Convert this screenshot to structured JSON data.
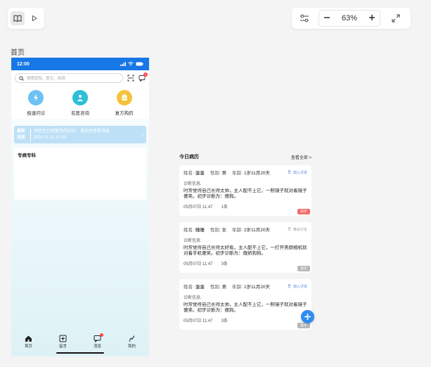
{
  "toolbar": {
    "left": {
      "book_icon": "book-open-icon",
      "play_icon": "play-icon"
    },
    "right": {
      "settings_icon": "sliders-icon",
      "zoom_out_icon": "minus-icon",
      "zoom_value": "63%",
      "zoom_in_icon": "plus-icon",
      "fullscreen_icon": "expand-icon"
    }
  },
  "page_label": "首页",
  "phone": {
    "status_bar": {
      "time": "12:00",
      "bg_color": "#1677e5"
    },
    "search": {
      "placeholder": "搜索医院、医生、疾病"
    },
    "message_badge": "2",
    "quick_actions": [
      {
        "label": "极速问诊",
        "icon": "lightning-icon",
        "color": "#6cc2f3"
      },
      {
        "label": "名医咨询",
        "icon": "doctor-icon",
        "color": "#2bbfd8"
      },
      {
        "label": "复方购药",
        "icon": "medicine-icon",
        "color": "#f5c23a"
      }
    ],
    "notice": {
      "tag": "最新消息",
      "text": "肖医生已回复你的问诊，请及时查看消息",
      "date": "2024.11.01 10:30"
    },
    "specialty_title": "专病专科",
    "tabbar": [
      {
        "label": "首页",
        "icon": "home-icon"
      },
      {
        "label": "留言",
        "icon": "compose-icon"
      },
      {
        "label": "消息",
        "icon": "message-icon"
      },
      {
        "label": "我的",
        "icon": "user-icon"
      }
    ]
  },
  "records": {
    "title": "今日病历",
    "view_all": "查看全部 >",
    "name_label": "姓名:",
    "gender_label": "性别:",
    "age_label": "年龄:",
    "diag_label": "诊断信息:",
    "items": [
      {
        "name": "蛋蛋",
        "gender": "男",
        "age": "1岁11月20天",
        "action": "加入讨论",
        "desc": "时常觉得自己长得太帅，主人配不上它，一照镜子就对着镜子傻笑。初步诊断为：傻狗。",
        "time": "05月07日 11:47",
        "count": "1条",
        "tag": "新步",
        "tag_color": "#f26d6d"
      },
      {
        "name": "睡睡",
        "gender": "女",
        "age": "2岁11月20天",
        "action": "移出讨论",
        "desc": "时常觉得自己长得太好看，主人配不上它，一打开美颜相机就对着手机傻笑。初步诊断为：傲娇狗狗。",
        "time": "05月07日 11:47",
        "count": "3条",
        "tag": "复步",
        "tag_color": "#b8b8b8"
      },
      {
        "name": "蛋蛋",
        "gender": "男",
        "age": "1岁11月20天",
        "action": "加入讨论",
        "desc": "时常觉得自己长得太帅，主人配不上它，一照镜子就对着镜子傻笑。初步诊断为：傻狗。",
        "time": "05月07日 11:47",
        "count": "3条",
        "tag": "复步",
        "tag_color": "#b8b8b8"
      }
    ]
  },
  "fab_icon": "plus-icon"
}
